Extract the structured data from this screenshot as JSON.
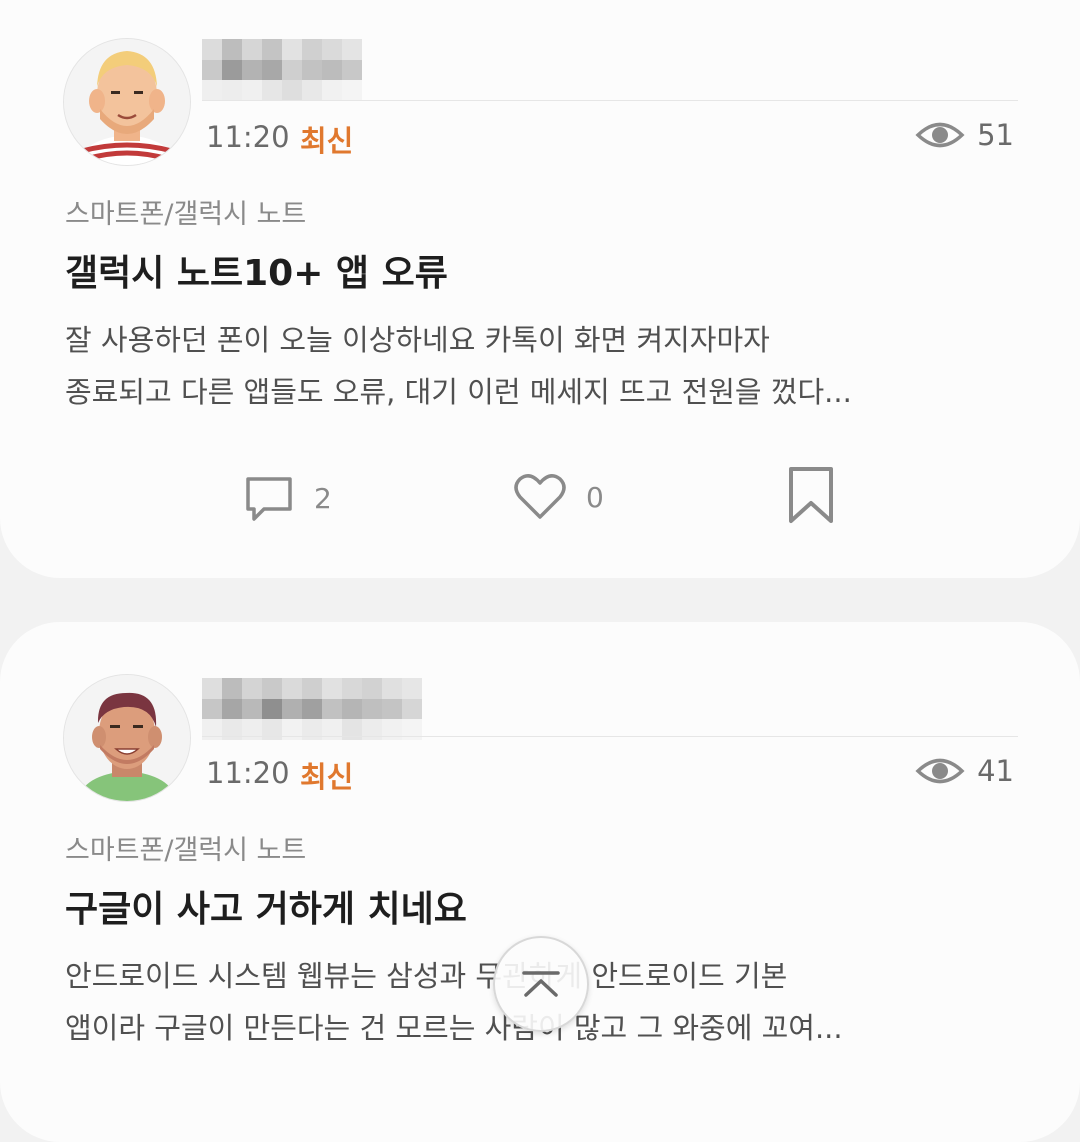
{
  "posts": [
    {
      "time": "11:20",
      "badge": "최신",
      "views": "51",
      "category": "스마트폰/갤럭시 노트",
      "title": "갤럭시 노트10+ 앱 오류",
      "body_lines": [
        "잘 사용하던 폰이 오늘 이상하네요 카톡이 화면 켜지자마자",
        "종료되고 다른 앱들도 오류, 대기 이런 메세지 뜨고 전원을 껐다..."
      ],
      "comments": "2",
      "likes": "0"
    },
    {
      "time": "11:20",
      "badge": "최신",
      "views": "41",
      "category": "스마트폰/갤럭시 노트",
      "title": "구글이 사고 거하게 치네요",
      "body_lines": [
        "안드로이드 시스템 웹뷰는 삼성과 무관하게 안드로이드 기본",
        "앱이라 구글이 만든다는 건 모르는 사람이 많고 그 와중에 꼬여..."
      ]
    }
  ],
  "icons": {
    "views": "eye-icon",
    "comment": "comment-icon",
    "like": "heart-icon",
    "bookmark": "bookmark-icon",
    "scroll_top": "chevron-up-icon"
  },
  "colors": {
    "accent": "#e0782e",
    "card": "#fcfcfc",
    "background": "#f2f2f2"
  }
}
